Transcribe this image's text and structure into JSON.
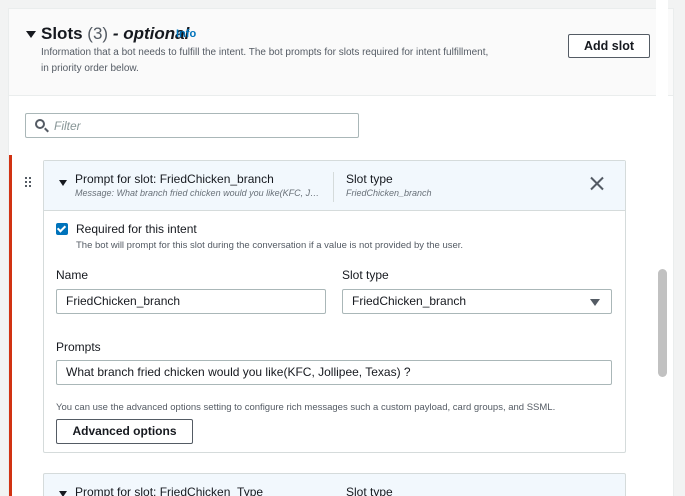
{
  "slots_section": {
    "title": "Slots",
    "count": "(3)",
    "optional_label": "- optional",
    "info_link": "Info",
    "description": "Information that a bot needs to fulfill the intent. The bot prompts for slots required for intent fulfillment, in priority order below.",
    "add_slot_label": "Add slot"
  },
  "filter": {
    "placeholder": "Filter"
  },
  "slot_card": {
    "header_title": "Prompt for slot: FriedChicken_branch",
    "header_message": "Message: What branch fried chicken would you like(KFC, Jollipee, Texas) ?",
    "slot_type_label": "Slot type",
    "slot_type_value": "FriedChicken_branch",
    "required_label": "Required for this intent",
    "required_checked": true,
    "required_desc": "The bot will prompt for this slot during the conversation if a value is not provided by the user.",
    "name_label": "Name",
    "name_value": "FriedChicken_branch",
    "type_label": "Slot type",
    "type_value": "FriedChicken_branch",
    "prompts_label": "Prompts",
    "prompt_value": "What branch fried chicken would you like(KFC, Jollipee, Texas) ?",
    "advanced_hint": "You can use the advanced options setting to configure rich messages such a custom payload, card groups, and SSML.",
    "advanced_button": "Advanced options"
  },
  "next_card": {
    "header_title": "Prompt for slot: FriedChicken_Type",
    "slot_type_label": "Slot type"
  },
  "colors": {
    "accent": "#0073bb",
    "error_bar": "#d13212",
    "card_header_bg": "#f2f8fd"
  }
}
